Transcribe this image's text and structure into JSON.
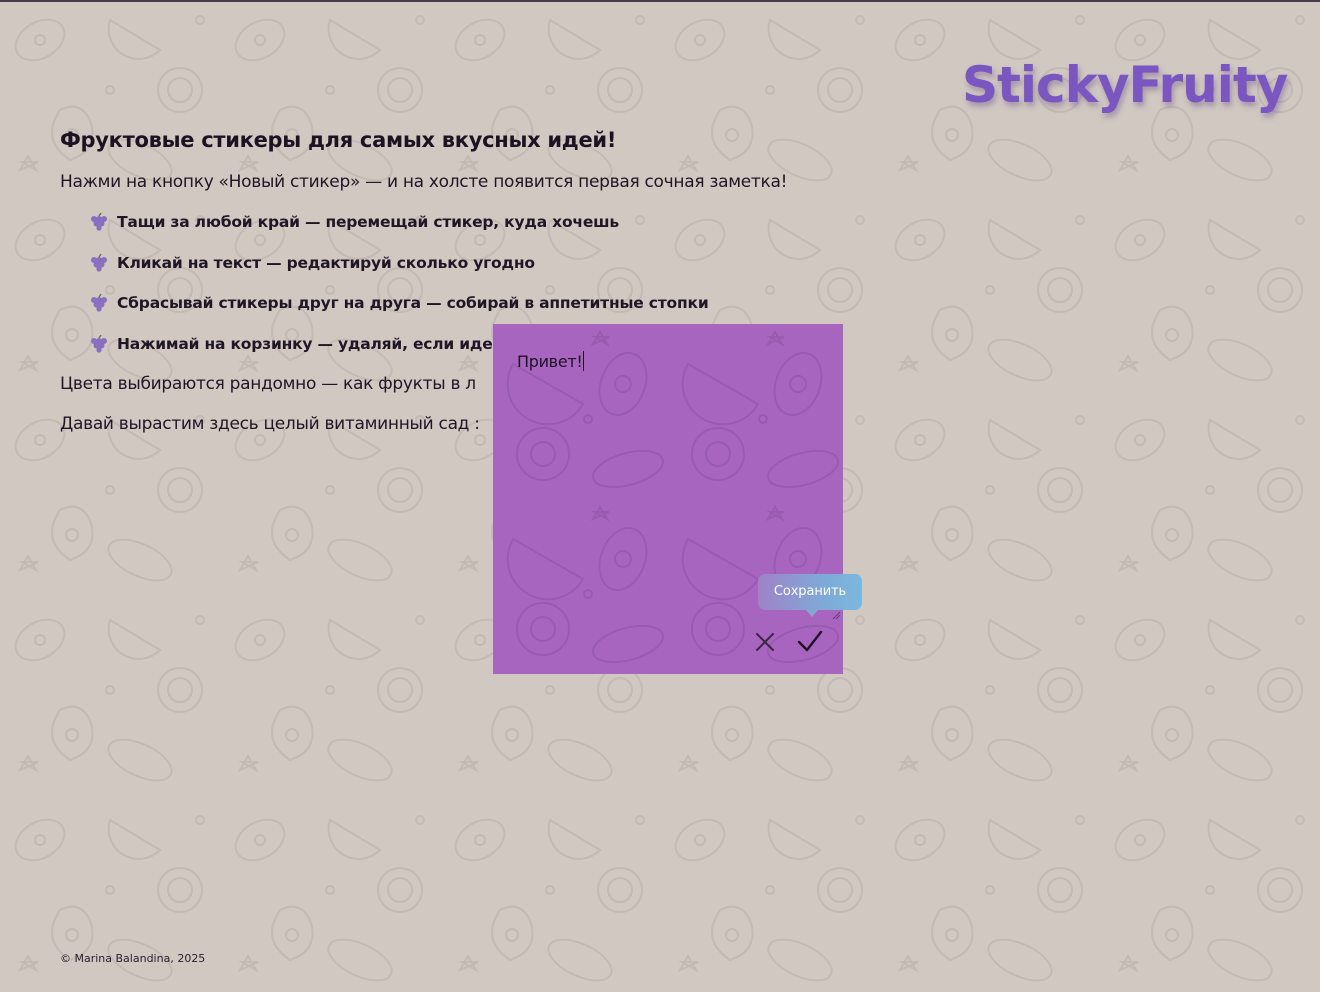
{
  "app": {
    "logo_text": "StickyFruity"
  },
  "intro": {
    "title": "Фруктовые стикеры для самых вкусных идей!",
    "lead": "Нажми на кнопку «Новый стикер» — и на холсте появится первая сочная заметка!",
    "tips": [
      {
        "icon": "grape-icon",
        "text": "Тащи за любой край — перемещай стикер, куда хочешь"
      },
      {
        "icon": "grape-icon",
        "text": "Кликай на текст — редактируй сколько угодно"
      },
      {
        "icon": "grape-icon",
        "text": "Сбрасывай стикеры друг на друга — собирай в аппетитные стопки"
      },
      {
        "icon": "grape-icon",
        "text": "Нажимай на корзинку — удаляй, если иде"
      }
    ],
    "line_colors": "Цвета выбираются рандомно — как фрукты в л",
    "line_garden": "Давай вырастим здесь целый витаминный сад :"
  },
  "sticker": {
    "text": "Привет!",
    "color": "#a765c0",
    "tooltip": "Сохранить",
    "cancel_icon": "close-icon",
    "save_icon": "checkmark-icon"
  },
  "footer": {
    "copyright": "© Marina Balandina, 2025"
  },
  "colors": {
    "background": "#d1c8c2",
    "logo": "#7a56c0",
    "text": "#1c1322"
  }
}
